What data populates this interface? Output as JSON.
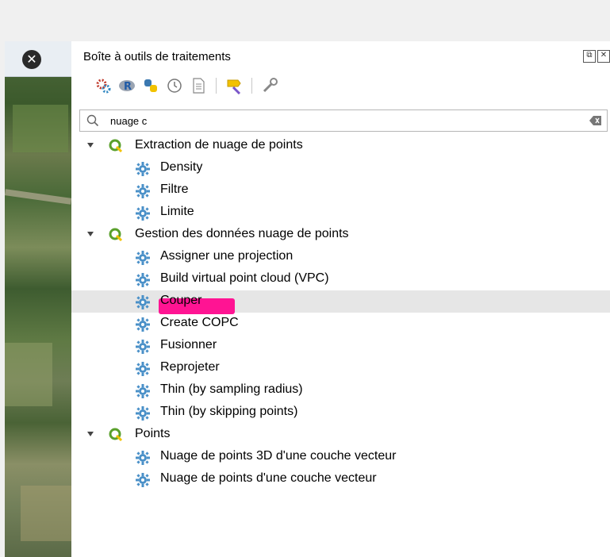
{
  "panel": {
    "title": "Boîte à outils de traitements"
  },
  "toolbar": {
    "icons": [
      "models-icon",
      "r-icon",
      "python-icon",
      "history-icon",
      "results-icon",
      "edit-features-icon",
      "options-icon"
    ]
  },
  "search": {
    "value": "nuage c",
    "placeholder": ""
  },
  "tree": {
    "groups": [
      {
        "label": "Extraction de nuage de points",
        "items": [
          {
            "label": "Density"
          },
          {
            "label": "Filtre"
          },
          {
            "label": "Limite"
          }
        ]
      },
      {
        "label": "Gestion des données nuage de points",
        "items": [
          {
            "label": "Assigner une projection"
          },
          {
            "label": "Build virtual point cloud (VPC)"
          },
          {
            "label": "Couper",
            "selected": true
          },
          {
            "label": "Create COPC"
          },
          {
            "label": "Fusionner"
          },
          {
            "label": "Reprojeter"
          },
          {
            "label": "Thin (by sampling radius)"
          },
          {
            "label": "Thin (by skipping points)"
          }
        ]
      },
      {
        "label": "Points",
        "items": [
          {
            "label": "Nuage de points 3D d'une couche vecteur"
          },
          {
            "label": "Nuage de points d'une couche vecteur"
          }
        ]
      }
    ]
  },
  "colors": {
    "qgis_green": "#5aa02c",
    "gear_blue": "#4a90c8",
    "highlight": "#ff1493"
  }
}
